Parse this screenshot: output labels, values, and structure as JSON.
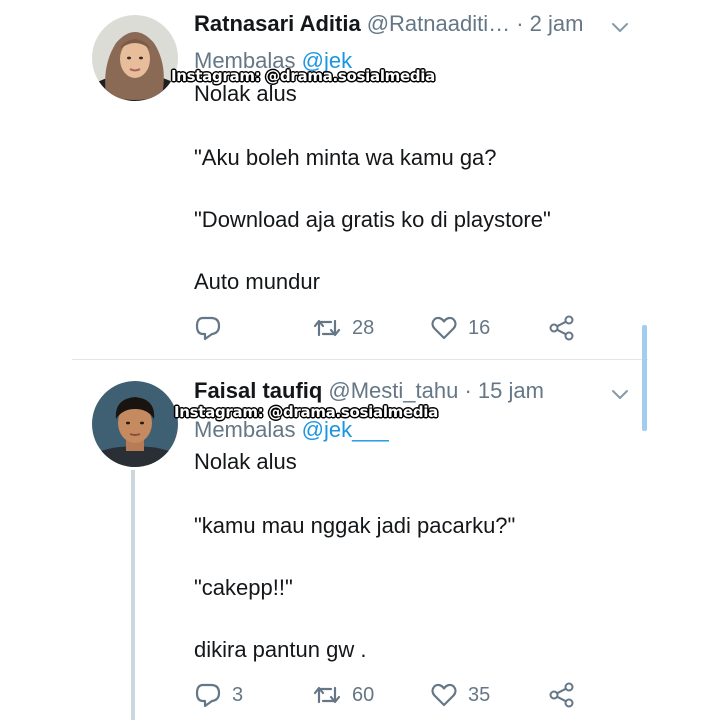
{
  "watermark": "Instagram: @drama.sosialmedia",
  "tweets": [
    {
      "display_name": "Ratnasari Aditia",
      "handle": "@Ratnaaditi…",
      "separator": "·",
      "time": "2 jam",
      "reply_prefix": "Membalas",
      "reply_mention": "@jek",
      "body": [
        "Nolak alus",
        "\"Aku boleh minta wa kamu ga?",
        "\"Download aja gratis ko di playstore\"",
        "Auto mundur"
      ],
      "replies": "",
      "retweets": "28",
      "likes": "16"
    },
    {
      "display_name": "Faisal taufiq",
      "handle": "@Mesti_tahu",
      "separator": "·",
      "time": "15 jam",
      "reply_prefix": "Membalas",
      "reply_mention": "@jek___",
      "body": [
        "Nolak alus",
        "\"kamu mau nggak jadi pacarku?\"",
        "\"cakepp!!\"",
        "dikira pantun gw ."
      ],
      "replies": "3",
      "retweets": "60",
      "likes": "35"
    }
  ],
  "icons": {
    "reply": "reply-icon",
    "retweet": "retweet-icon",
    "like": "heart-icon",
    "share": "share-icon",
    "menu": "chevron-down-icon"
  },
  "colors": {
    "text": "#14171a",
    "muted": "#657786",
    "link": "#1b95e0",
    "divider": "#e1e8ed",
    "thread_line": "#ccd6dd",
    "scrollbar": "#a3cdef"
  }
}
